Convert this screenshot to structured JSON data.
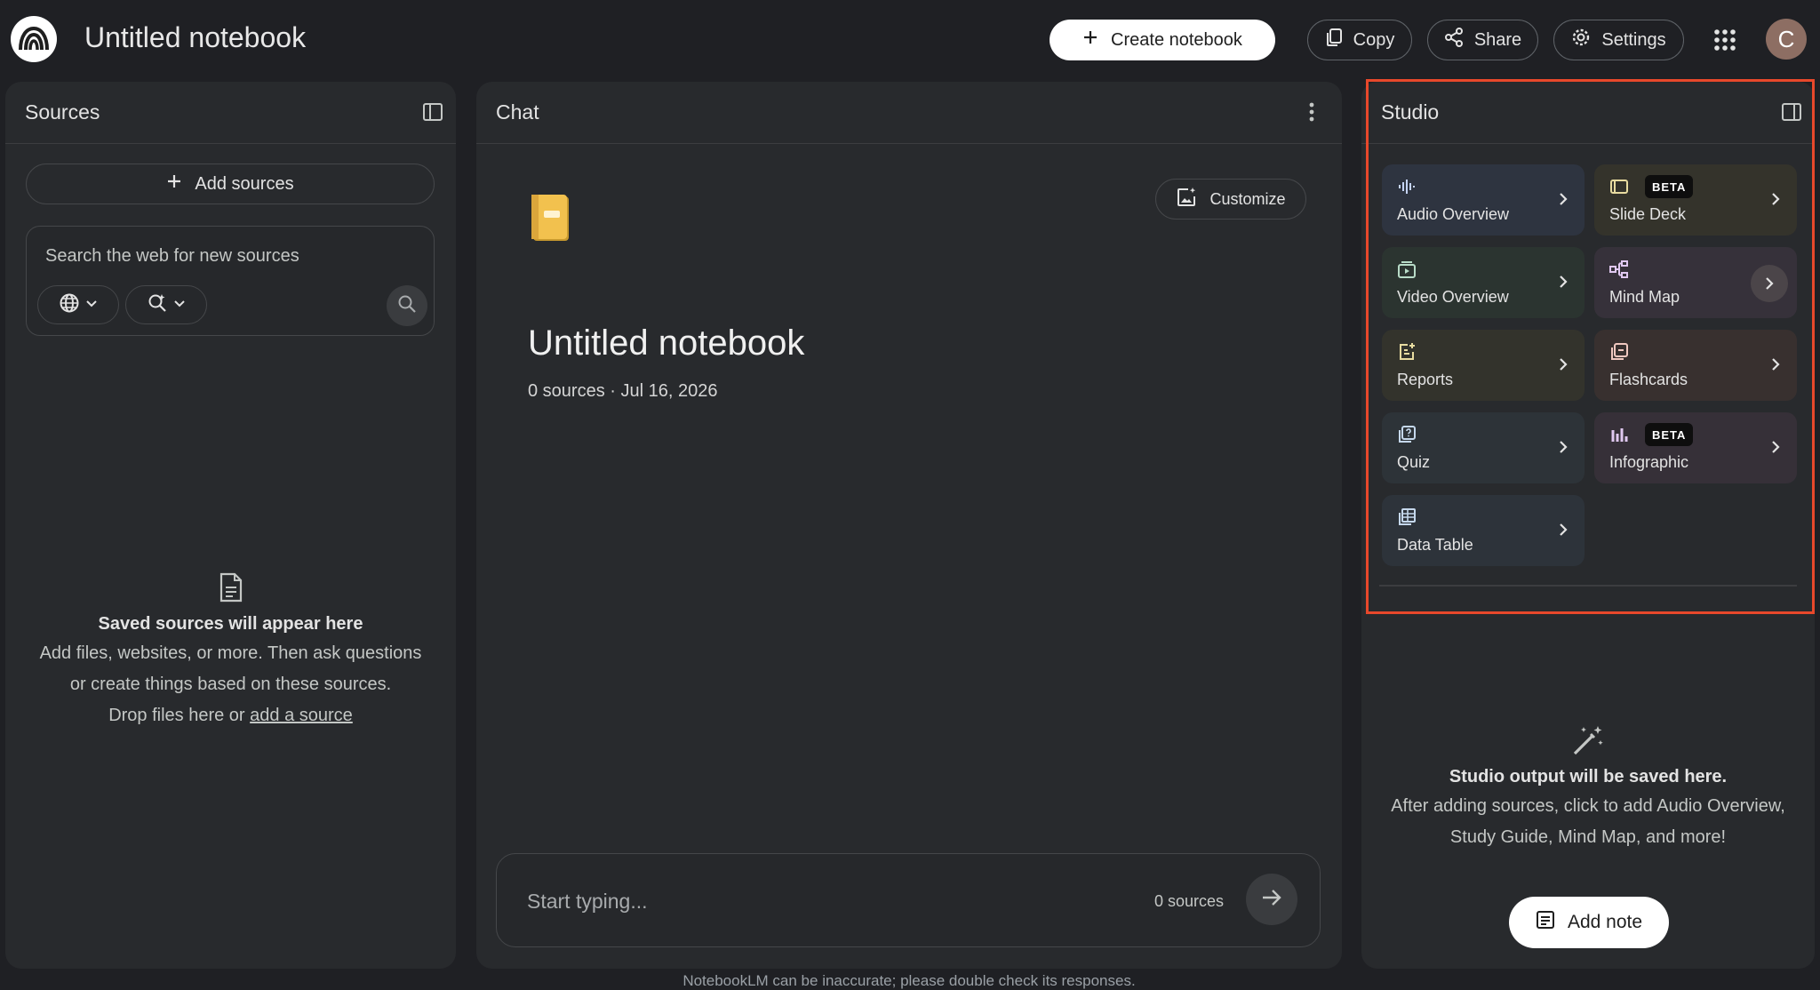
{
  "app": {
    "title": "Untitled notebook",
    "logo_icon": "notebooklm-logo-icon"
  },
  "toolbar": {
    "create_label": "Create notebook",
    "copy_label": "Copy",
    "share_label": "Share",
    "settings_label": "Settings",
    "avatar_initial": "C"
  },
  "sources": {
    "header": "Sources",
    "add_label": "Add sources",
    "search_placeholder": "Search the web for new sources",
    "empty_title": "Saved sources will appear here",
    "empty_line1": "Add files, websites, or more. Then ask questions",
    "empty_line2": "or create things based on these sources.",
    "empty_line3_prefix": "Drop files here or ",
    "empty_link": "add a source"
  },
  "chat": {
    "header": "Chat",
    "customize_label": "Customize",
    "notebook_title": "Untitled notebook",
    "meta": "0 sources · Jul 16, 2026",
    "input_placeholder": "Start typing...",
    "source_count": "0 sources",
    "disclaimer": "NotebookLM can be inaccurate; please double check its responses."
  },
  "studio": {
    "header": "Studio",
    "tiles": [
      {
        "label": "Audio Overview",
        "icon": "audio-waveform-icon",
        "bg": "#2e3440",
        "beta": false
      },
      {
        "label": "Slide Deck",
        "icon": "slides-icon",
        "bg": "#34332b",
        "beta": true,
        "badge": "BETA"
      },
      {
        "label": "Video Overview",
        "icon": "video-icon",
        "bg": "#2b3430",
        "beta": false
      },
      {
        "label": "Mind Map",
        "icon": "mind-map-icon",
        "bg": "#36313a",
        "beta": false
      },
      {
        "label": "Reports",
        "icon": "reports-icon",
        "bg": "#33332c",
        "beta": false
      },
      {
        "label": "Flashcards",
        "icon": "flashcards-icon",
        "bg": "#38302f",
        "beta": false
      },
      {
        "label": "Quiz",
        "icon": "quiz-icon",
        "bg": "#2d3338",
        "beta": false
      },
      {
        "label": "Infographic",
        "icon": "infographic-icon",
        "bg": "#363038",
        "beta": true,
        "badge": "BETA"
      },
      {
        "label": "Data Table",
        "icon": "table-icon",
        "bg": "#2d333a",
        "beta": false
      }
    ],
    "empty_title": "Studio output will be saved here.",
    "empty_line1": "After adding sources, click to add Audio Overview,",
    "empty_line2": "Study Guide, Mind Map, and more!",
    "add_note_label": "Add note",
    "highlight_color": "#e8482b"
  }
}
